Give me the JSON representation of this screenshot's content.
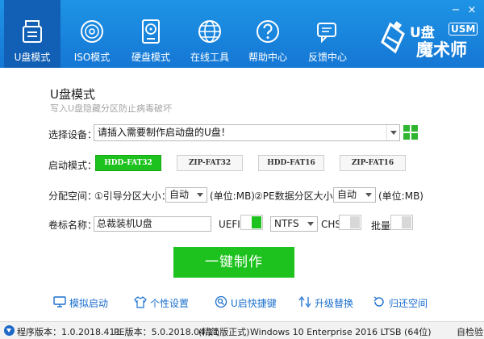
{
  "nav": {
    "tabs": [
      {
        "label": "U盘模式",
        "icon": "usb-drive-icon"
      },
      {
        "label": "ISO模式",
        "icon": "disc-icon"
      },
      {
        "label": "硬盘模式",
        "icon": "hard-disk-icon"
      },
      {
        "label": "在线工具",
        "icon": "globe-icon"
      },
      {
        "label": "帮助中心",
        "icon": "help-icon"
      },
      {
        "label": "反馈中心",
        "icon": "feedback-icon"
      }
    ],
    "active_index": 0
  },
  "window": {
    "minimize": "−",
    "close": "×"
  },
  "logo": {
    "cn_top": "U盘",
    "cn_bottom": "魔术师",
    "en": "USM"
  },
  "main": {
    "title": "U盘模式",
    "subtitle": "写入U盘隐藏分区防止病毒破坏",
    "device": {
      "label": "选择设备：",
      "value": "请插入需要制作启动盘的U盘！"
    },
    "boot_mode": {
      "label": "启动模式：",
      "options": [
        "HDD-FAT32",
        "ZIP-FAT32",
        "HDD-FAT16",
        "ZIP-FAT16"
      ],
      "selected_index": 0
    },
    "partition": {
      "label": "分配空间：",
      "boot_label": "①引导分区大小：",
      "boot_value": "自动",
      "boot_unit": "(单位:MB)",
      "pe_label": "②PE数据分区大小：",
      "pe_value": "自动",
      "pe_unit": "(单位:MB)"
    },
    "volume": {
      "label": "卷标名称：",
      "value": "总裁装机U盘",
      "uefi_label": "UEFI:",
      "uefi_on": true,
      "fs_value": "NTFS",
      "chs_label": "CHS:",
      "chs_on": false,
      "batch_label": "批量:",
      "batch_on": false
    },
    "make_button": "一键制作",
    "links": [
      {
        "label": "模拟启动",
        "icon": "monitor-icon"
      },
      {
        "label": "个性设置",
        "icon": "shirt-icon"
      },
      {
        "label": "U启快捷键",
        "icon": "key-search-icon"
      },
      {
        "label": "升级替换",
        "icon": "upgrade-icon"
      },
      {
        "label": "归还空间",
        "icon": "restore-icon"
      }
    ]
  },
  "status": {
    "program_version": "程序版本：1.0.2018.411",
    "pe_version": "PE版本：5.0.2018.04.11",
    "edition": "(精简版正式)",
    "os": "Windows 10 Enterprise 2016 LTSB (64位)",
    "self_check": "自检验"
  },
  "colors": {
    "header": "#1577d4",
    "active_tab": "#1260b5",
    "accent_green": "#1ec21e",
    "link_blue": "#1b6fce"
  }
}
